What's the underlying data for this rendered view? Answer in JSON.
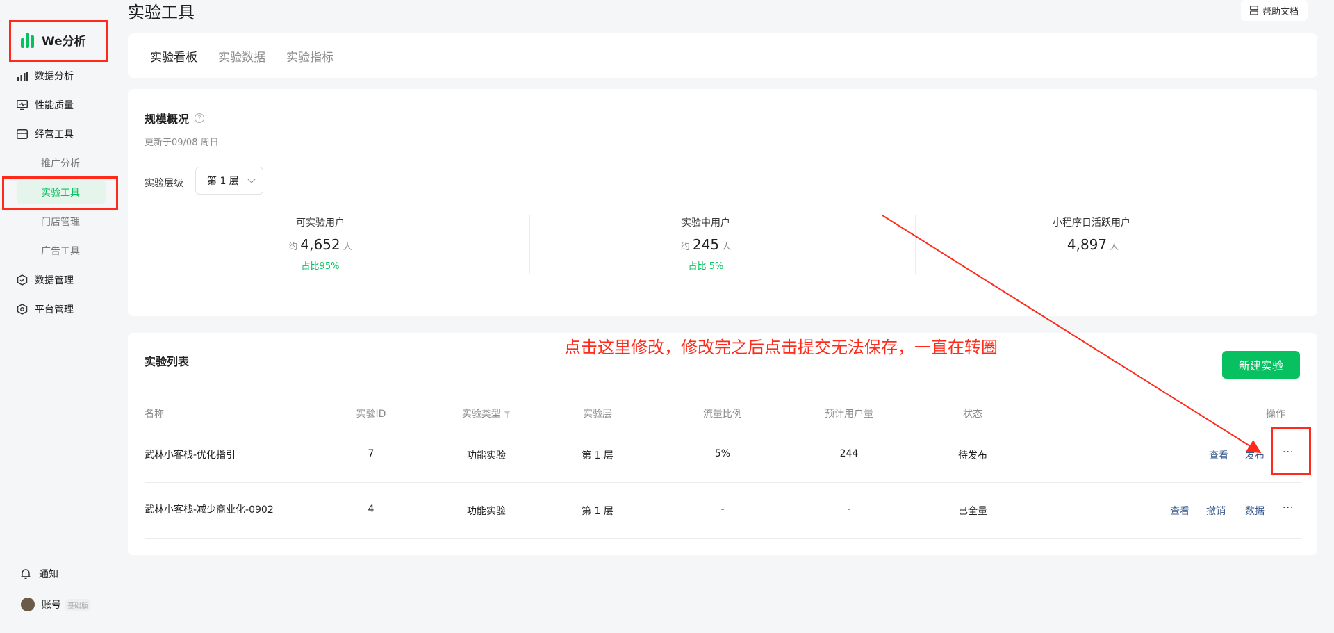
{
  "sidebar": {
    "logo": "We分析",
    "items": [
      {
        "label": "数据分析"
      },
      {
        "label": "性能质量"
      },
      {
        "label": "经营工具"
      }
    ],
    "sub_items": [
      {
        "label": "推广分析"
      },
      {
        "label": "实验工具"
      },
      {
        "label": "门店管理"
      },
      {
        "label": "广告工具"
      }
    ],
    "items2": [
      {
        "label": "数据管理"
      },
      {
        "label": "平台管理"
      }
    ],
    "notification": "通知",
    "account": "账号",
    "account_badge": "基础版"
  },
  "header": {
    "title": "实验工具",
    "help": "帮助文档"
  },
  "tabs": [
    {
      "label": "实验看板"
    },
    {
      "label": "实验数据"
    },
    {
      "label": "实验指标"
    }
  ],
  "overview": {
    "title": "规模概况",
    "help_icon": "?",
    "updated": "更新于09/08 周日",
    "layer_label": "实验层级",
    "layer_value": "第 1 层",
    "stats": [
      {
        "label": "可实验用户",
        "prefix": "约",
        "value": "4,652",
        "unit": "人",
        "ratio": "占比95%"
      },
      {
        "label": "实验中用户",
        "prefix": "约",
        "value": "245",
        "unit": "人",
        "ratio": "占比 5%"
      },
      {
        "label": "小程序日活跃用户",
        "prefix": "",
        "value": "4,897",
        "unit": "人",
        "ratio": ""
      }
    ]
  },
  "list": {
    "title": "实验列表",
    "new_button": "新建实验",
    "columns": [
      "名称",
      "实验ID",
      "实验类型",
      "实验层",
      "流量比例",
      "预计用户量",
      "状态",
      "操作"
    ],
    "rows": [
      {
        "name": "武林小客栈-优化指引",
        "id": "7",
        "type": "功能实验",
        "layer": "第 1 层",
        "ratio": "5%",
        "users": "244",
        "status": "待发布",
        "ops": [
          "查看",
          "发布"
        ]
      },
      {
        "name": "武林小客栈-减少商业化-0902",
        "id": "4",
        "type": "功能实验",
        "layer": "第 1 层",
        "ratio": "-",
        "users": "-",
        "status": "已全量",
        "ops": [
          "查看",
          "撤销",
          "数据"
        ]
      }
    ],
    "more": "···"
  },
  "annotation": "点击这里修改，修改完之后点击提交无法保存，一直在转圈",
  "colors": {
    "accent": "#07c160",
    "annotation": "#ff2a1a",
    "link": "#3a5a8c"
  }
}
